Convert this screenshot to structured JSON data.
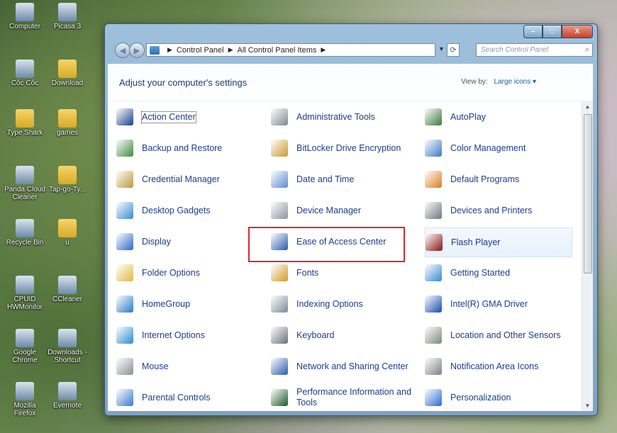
{
  "desktop": {
    "icons": [
      {
        "label": "Computer",
        "icon": "computer-icon"
      },
      {
        "label": "Picasa 3",
        "icon": "picasa-icon"
      },
      {
        "label": "Cốc Cốc",
        "icon": "coccoc-icon"
      },
      {
        "label": "Download",
        "icon": "folder-icon"
      },
      {
        "label": "Type Shark",
        "icon": "folder-icon"
      },
      {
        "label": "games",
        "icon": "folder-icon"
      },
      {
        "label": "Panda Cloud Cleaner",
        "icon": "panda-icon"
      },
      {
        "label": "Tap-go-Ty...",
        "icon": "folder-icon"
      },
      {
        "label": "Recycle Bin",
        "icon": "recycle-bin-icon"
      },
      {
        "label": "u",
        "icon": "folder-icon"
      },
      {
        "label": "CPUID HWMonitor",
        "icon": "cpuid-icon"
      },
      {
        "label": "CCleaner",
        "icon": "ccleaner-icon"
      },
      {
        "label": "Google Chrome",
        "icon": "chrome-icon"
      },
      {
        "label": "Downloads - Shortcut",
        "icon": "shortcut-icon"
      },
      {
        "label": "Mozilla Firefox",
        "icon": "firefox-icon"
      },
      {
        "label": "Evernote",
        "icon": "evernote-icon"
      }
    ]
  },
  "window": {
    "buttons": {
      "minimize": "–",
      "maximize": "□",
      "close": "X"
    },
    "breadcrumb": [
      "Control Panel",
      "All Control Panel Items"
    ],
    "search_placeholder": "Search Control Panel",
    "page_title": "Adjust your computer's settings",
    "view_by_label": "View by:",
    "view_by_value": "Large icons ▾"
  },
  "items": [
    {
      "label": "Action Center",
      "icon": "flag-icon",
      "color": "#1b3f8a"
    },
    {
      "label": "Administrative Tools",
      "icon": "admin-tools-icon",
      "color": "#7d8a95"
    },
    {
      "label": "AutoPlay",
      "icon": "autoplay-icon",
      "color": "#3a7a3a"
    },
    {
      "label": "Backup and Restore",
      "icon": "backup-icon",
      "color": "#3d8a3d"
    },
    {
      "label": "BitLocker Drive Encryption",
      "icon": "bitlocker-icon",
      "color": "#c79a2a"
    },
    {
      "label": "Color Management",
      "icon": "color-mgmt-icon",
      "color": "#3a78c8"
    },
    {
      "label": "Credential Manager",
      "icon": "credential-icon",
      "color": "#b99a3a"
    },
    {
      "label": "Date and Time",
      "icon": "clock-icon",
      "color": "#5a8ad0"
    },
    {
      "label": "Default Programs",
      "icon": "default-programs-icon",
      "color": "#e07a1a"
    },
    {
      "label": "Desktop Gadgets",
      "icon": "gadgets-icon",
      "color": "#3a8ad0"
    },
    {
      "label": "Device Manager",
      "icon": "device-manager-icon",
      "color": "#8a949e"
    },
    {
      "label": "Devices and Printers",
      "icon": "printer-icon",
      "color": "#6a7480"
    },
    {
      "label": "Display",
      "icon": "display-icon",
      "color": "#2a6ac8"
    },
    {
      "label": "Ease of Access Center",
      "icon": "ease-access-icon",
      "color": "#2a5ab0"
    },
    {
      "label": "Flash Player",
      "icon": "flash-icon",
      "color": "#8a1010"
    },
    {
      "label": "Folder Options",
      "icon": "folder-options-icon",
      "color": "#e0b840"
    },
    {
      "label": "Fonts",
      "icon": "fonts-icon",
      "color": "#d09a2a"
    },
    {
      "label": "Getting Started",
      "icon": "getting-started-icon",
      "color": "#3a8ad0"
    },
    {
      "label": "HomeGroup",
      "icon": "homegroup-icon",
      "color": "#2a7ac8"
    },
    {
      "label": "Indexing Options",
      "icon": "indexing-icon",
      "color": "#7a8a9a"
    },
    {
      "label": "Intel(R) GMA Driver",
      "icon": "intel-icon",
      "color": "#1a4ab0"
    },
    {
      "label": "Internet Options",
      "icon": "internet-options-icon",
      "color": "#2a8ad0"
    },
    {
      "label": "Keyboard",
      "icon": "keyboard-icon",
      "color": "#6a7078"
    },
    {
      "label": "Location and Other Sensors",
      "icon": "location-icon",
      "color": "#7a8a7a"
    },
    {
      "label": "Mouse",
      "icon": "mouse-icon",
      "color": "#8a9098"
    },
    {
      "label": "Network and Sharing Center",
      "icon": "network-icon",
      "color": "#2a5ab0"
    },
    {
      "label": "Notification Area Icons",
      "icon": "notification-icon",
      "color": "#7a8088"
    },
    {
      "label": "Parental Controls",
      "icon": "parental-icon",
      "color": "#3a7ac8"
    },
    {
      "label": "Performance Information and Tools",
      "icon": "performance-icon",
      "color": "#1a5a2a"
    },
    {
      "label": "Personalization",
      "icon": "personalization-icon",
      "color": "#2a6ad0"
    }
  ]
}
